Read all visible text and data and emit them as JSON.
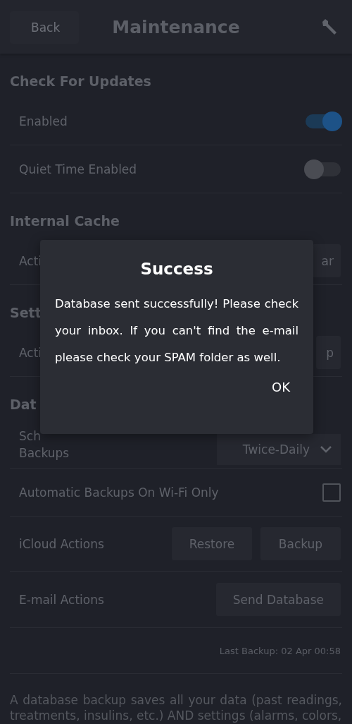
{
  "header": {
    "back": "Back",
    "title": "Maintenance"
  },
  "sections": [
    {
      "title": "Check For Updates",
      "rows": [
        {
          "kind": "toggle",
          "label": "Enabled",
          "on": true
        },
        {
          "kind": "toggle",
          "label": "Quiet Time Enabled",
          "on": false
        }
      ]
    },
    {
      "title": "Internal Cache",
      "rows": [
        {
          "kind": "buttons",
          "label": "Acti",
          "buttons": [
            "ar"
          ]
        }
      ]
    },
    {
      "title": "Sett",
      "rows": [
        {
          "kind": "buttons",
          "label": "Acti",
          "buttons": [
            "p"
          ]
        }
      ]
    },
    {
      "title": "Dat",
      "rows": [
        {
          "kind": "select",
          "label_lines": [
            "Sch",
            "Backups"
          ],
          "value": "Twice-Daily"
        },
        {
          "kind": "checkbox",
          "label": "Automatic Backups On Wi-Fi Only",
          "checked": false
        },
        {
          "kind": "buttons",
          "label": "iCloud Actions",
          "buttons": [
            "Restore",
            "Backup"
          ]
        },
        {
          "kind": "buttons",
          "label": "E-mail Actions",
          "buttons": [
            "Send Database"
          ]
        },
        {
          "kind": "note",
          "text": "Last Backup: 02 Apr 00:58"
        }
      ]
    }
  ],
  "footer_text": "A database backup saves all your data (past readings, treatments, insulins, etc.) AND settings (alarms, colors,",
  "dialog": {
    "title": "Success",
    "message": "Database sent successfully! Please check your inbox. If you can't find the e-mail please check your SPAM folder as well.",
    "button": "OK"
  }
}
